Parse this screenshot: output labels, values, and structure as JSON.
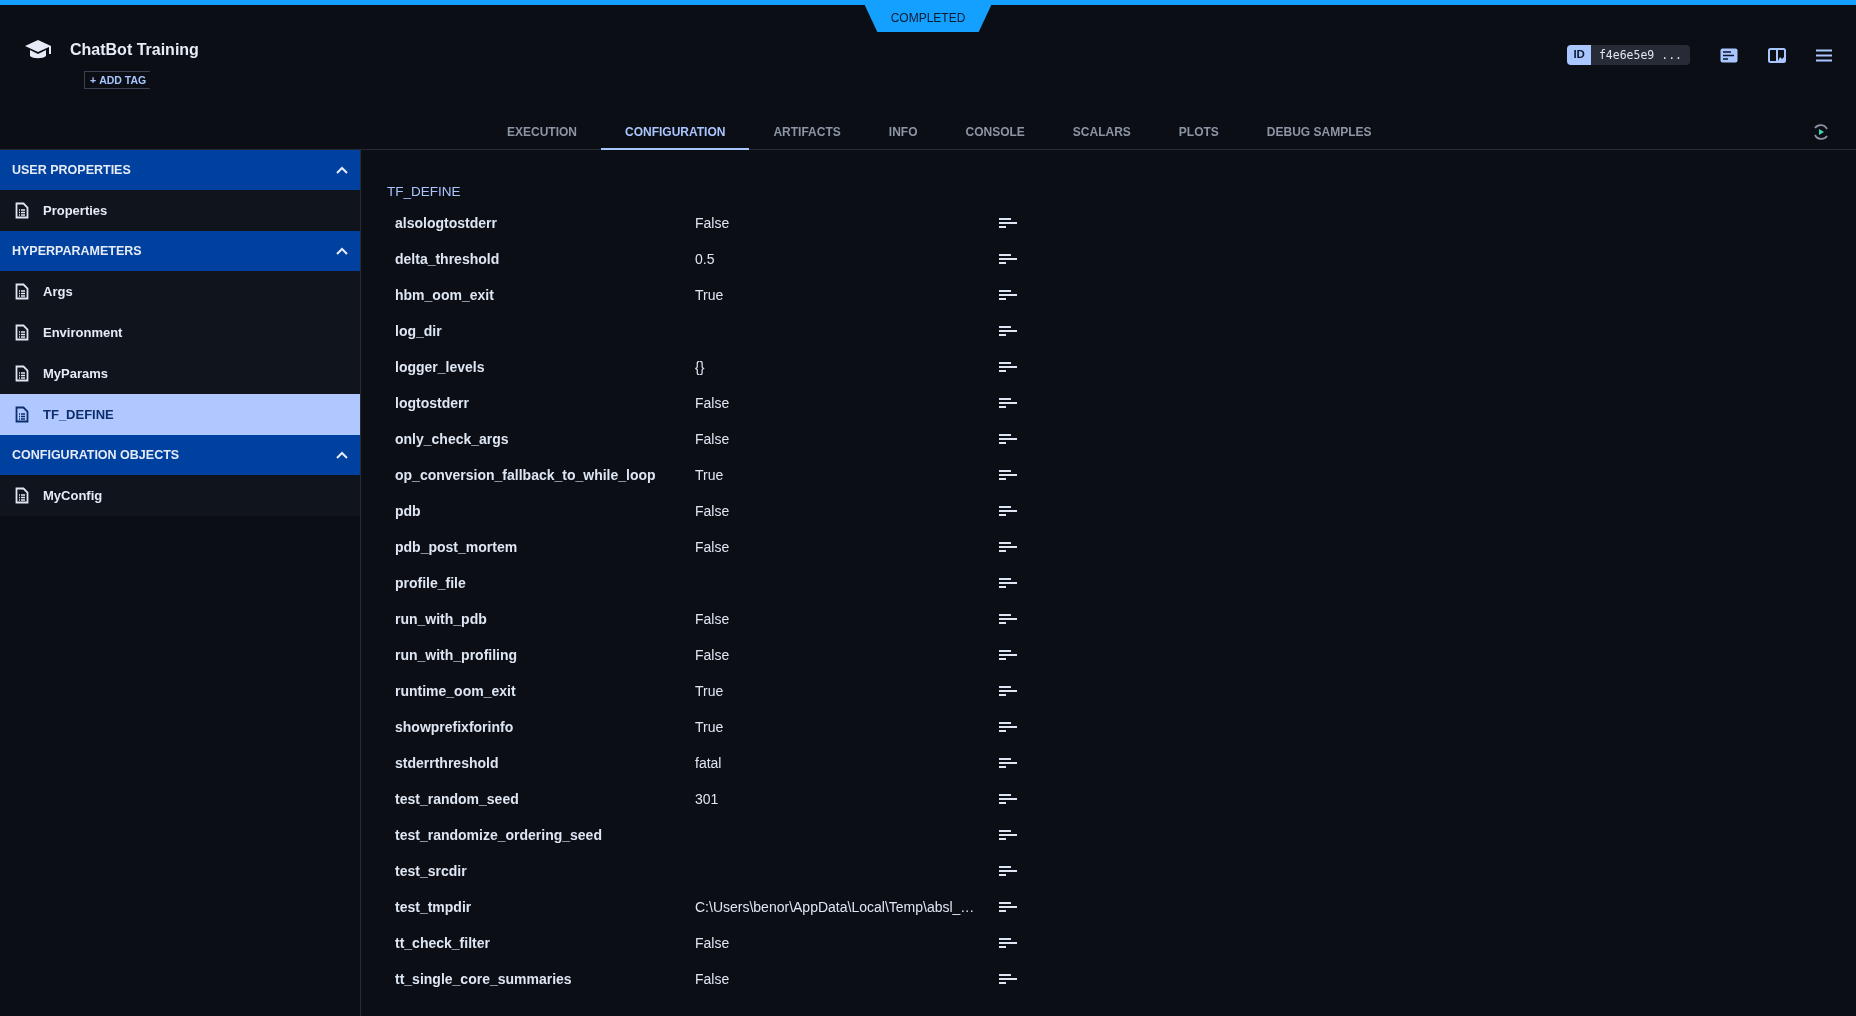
{
  "status_badge": "COMPLETED",
  "header": {
    "title": "ChatBot Training",
    "add_tag": "ADD TAG",
    "add_tag_icon": "+",
    "id_label": "ID",
    "id_value": "f4e6e5e9 ..."
  },
  "tabs": [
    {
      "label": "EXECUTION",
      "selected": false
    },
    {
      "label": "CONFIGURATION",
      "selected": true
    },
    {
      "label": "ARTIFACTS",
      "selected": false
    },
    {
      "label": "INFO",
      "selected": false
    },
    {
      "label": "CONSOLE",
      "selected": false
    },
    {
      "label": "SCALARS",
      "selected": false
    },
    {
      "label": "PLOTS",
      "selected": false
    },
    {
      "label": "DEBUG SAMPLES",
      "selected": false
    }
  ],
  "sidebar": {
    "sections": [
      {
        "title": "USER PROPERTIES",
        "expanded": true,
        "items": [
          {
            "label": "Properties",
            "selected": false
          }
        ]
      },
      {
        "title": "HYPERPARAMETERS",
        "expanded": true,
        "items": [
          {
            "label": "Args",
            "selected": false
          },
          {
            "label": "Environment",
            "selected": false
          },
          {
            "label": "MyParams",
            "selected": false
          },
          {
            "label": "TF_DEFINE",
            "selected": true
          }
        ]
      },
      {
        "title": "CONFIGURATION OBJECTS",
        "expanded": true,
        "items": [
          {
            "label": "MyConfig",
            "selected": false
          }
        ]
      }
    ]
  },
  "section_title": "TF_DEFINE",
  "params": [
    {
      "name": "alsologtostderr",
      "value": "False"
    },
    {
      "name": "delta_threshold",
      "value": "0.5"
    },
    {
      "name": "hbm_oom_exit",
      "value": "True"
    },
    {
      "name": "log_dir"
    },
    {
      "name": "logger_levels",
      "value": "{}"
    },
    {
      "name": "logtostderr",
      "value": "False"
    },
    {
      "name": "only_check_args",
      "value": "False"
    },
    {
      "name": "op_conversion_fallback_to_while_loop",
      "value": "True"
    },
    {
      "name": "pdb",
      "value": "False"
    },
    {
      "name": "pdb_post_mortem",
      "value": "False"
    },
    {
      "name": "profile_file"
    },
    {
      "name": "run_with_pdb",
      "value": "False"
    },
    {
      "name": "run_with_profiling",
      "value": "False"
    },
    {
      "name": "runtime_oom_exit",
      "value": "True"
    },
    {
      "name": "showprefixforinfo",
      "value": "True"
    },
    {
      "name": "stderrthreshold",
      "value": "fatal"
    },
    {
      "name": "test_random_seed",
      "value": "301"
    },
    {
      "name": "test_randomize_ordering_seed"
    },
    {
      "name": "test_srcdir"
    },
    {
      "name": "test_tmpdir",
      "value": "C:\\Users\\benor\\AppData\\Local\\Temp\\absl_…"
    },
    {
      "name": "tt_check_filter",
      "value": "False"
    },
    {
      "name": "tt_single_core_summaries",
      "value": "False"
    }
  ]
}
